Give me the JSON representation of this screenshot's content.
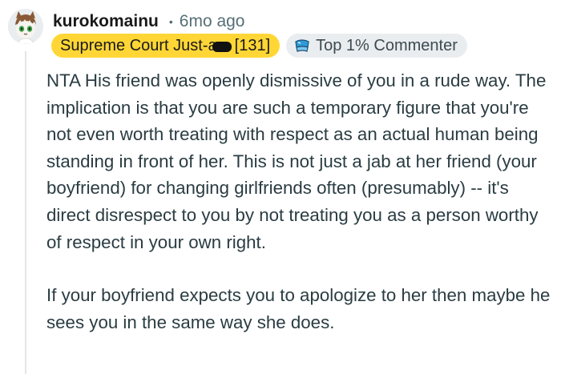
{
  "comment": {
    "username": "kurokomainu",
    "separator": "•",
    "time": "6mo ago",
    "flair_prefix": "Supreme Court Just-a",
    "flair_suffix": "[131]",
    "badge_label": "Top 1% Commenter",
    "paragraphs": [
      "NTA His friend was openly dismissive of you in a rude way. The implication is that you are such a temporary figure that you're not even worth treating with respect as an actual human being standing in front of her. This is not just a jab at her friend (your boyfriend) for changing girlfriends often (presumably) -- it's direct disrespect to you by not treating you as a person worthy of respect in your own right.",
      "If your boyfriend expects you to apologize to her then maybe he sees you in the same way she does."
    ]
  },
  "colors": {
    "flair_bg": "#ffd635",
    "badge_bg": "#eaedef",
    "thread_line": "#e3e5e8",
    "body_text": "#2a3c42"
  },
  "icons": {
    "avatar": "avatar",
    "badge": "top-commenter-icon"
  }
}
